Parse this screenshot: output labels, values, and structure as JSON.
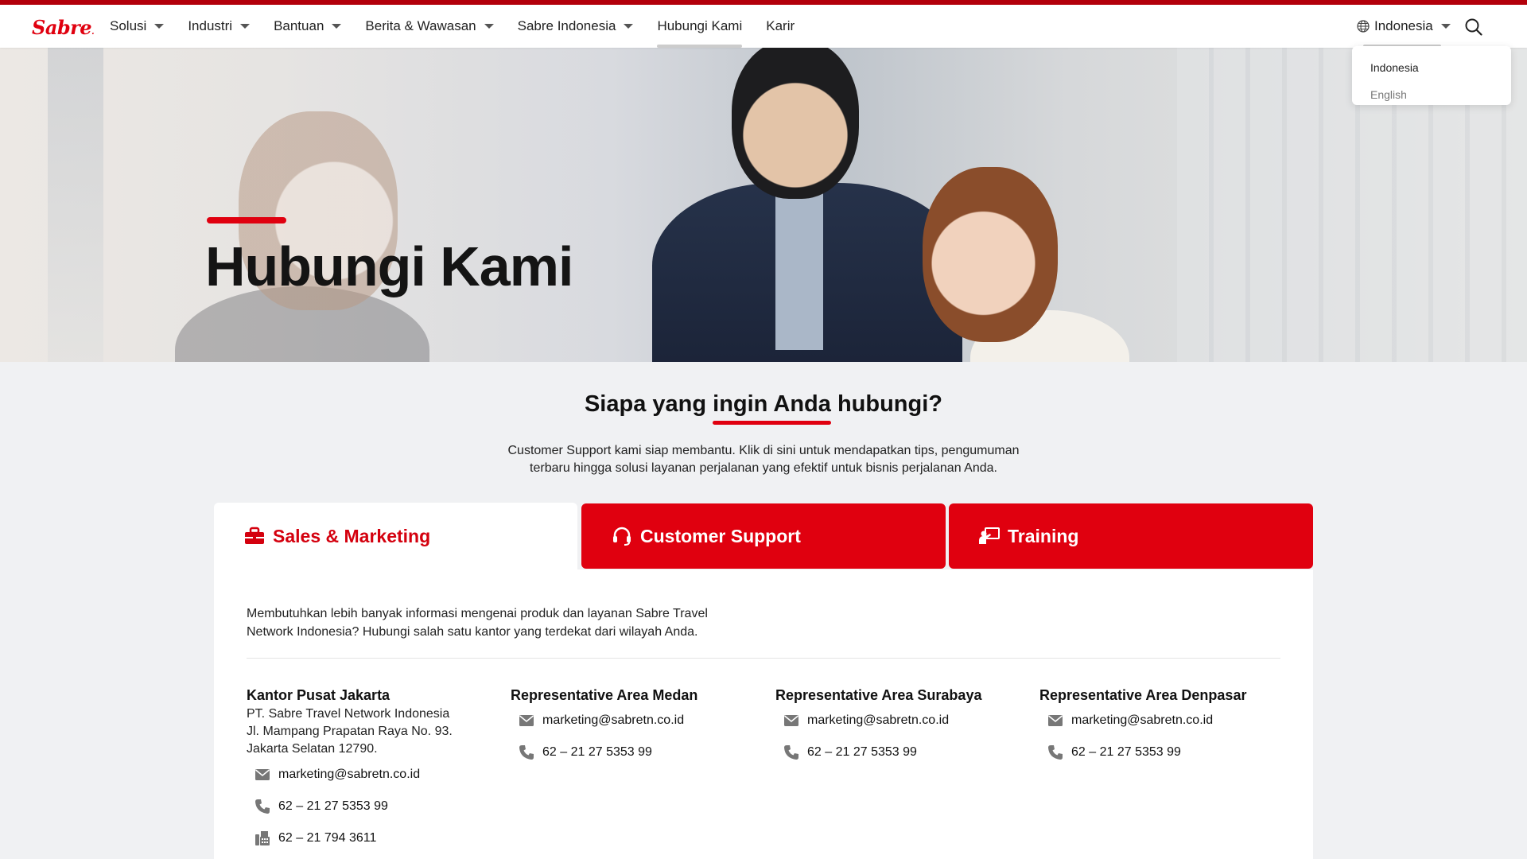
{
  "header": {
    "logo_text": "Sabre",
    "nav": [
      "Solusi",
      "Industri",
      "Bantuan",
      "Berita & Wawasan",
      "Sabre Indonesia",
      "Hubungi Kami",
      "Karir"
    ],
    "language": "Indonesia",
    "language_menu": [
      "Indonesia",
      "English"
    ]
  },
  "hero": {
    "title": "Hubungi Kami"
  },
  "intro": {
    "title_pre": "Siapa yang ",
    "title_underlined": "ingin Anda",
    "title_post": " hubungi?",
    "description": "Customer Support kami siap membantu. Klik di sini untuk mendapatkan tips, pengumuman terbaru hingga solusi layanan perjalanan yang efektif untuk bisnis perjalanan Anda."
  },
  "tabs": {
    "sales": "Sales & Marketing",
    "support": "Customer Support",
    "training": "Training"
  },
  "panel": {
    "description": "Membutuhkan lebih banyak informasi mengenai produk dan layanan Sabre Travel Network Indonesia? Hubungi salah satu kantor yang terdekat dari wilayah Anda.",
    "offices": [
      {
        "name": "Kantor Pusat Jakarta",
        "address": [
          "PT. Sabre Travel Network Indonesia",
          "Jl. Mampang Prapatan Raya No. 93.",
          "Jakarta Selatan 12790."
        ],
        "email": "marketing@sabretn.co.id",
        "phone": "62 – 21 27 5353 99",
        "fax": "62 – 21 794 3611"
      },
      {
        "name": "Representative Area Medan",
        "email": "marketing@sabretn.co.id",
        "phone": "62 – 21 27 5353 99"
      },
      {
        "name": "Representative Area Surabaya",
        "email": "marketing@sabretn.co.id",
        "phone": "62 – 21 27 5353 99"
      },
      {
        "name": "Representative Area Denpasar",
        "email": "marketing@sabretn.co.id",
        "phone": "62 – 21 27 5353 99"
      }
    ]
  },
  "colors": {
    "brand_red": "#e0000f",
    "top_bar": "#b3000b",
    "background": "#f0f1f3"
  }
}
